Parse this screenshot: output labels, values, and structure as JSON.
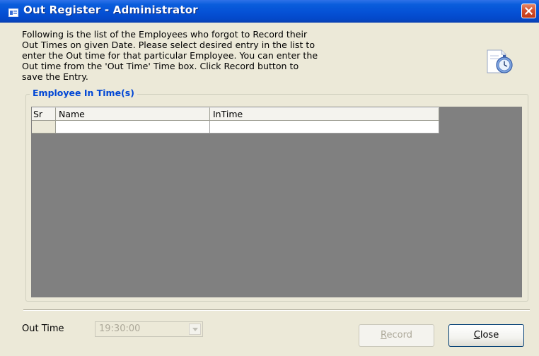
{
  "window": {
    "title": "Out Register - Administrator"
  },
  "description": {
    "lines": [
      "Following is the list of the Employees who forgot to Record their",
      "Out Times on given Date. Please select desired entry in the list to",
      "enter the Out time for that particular Employee. You can enter the",
      "Out time from the 'Out Time' Time box. Click Record button to",
      "save the Entry."
    ]
  },
  "group": {
    "title": "Employee In Time(s)"
  },
  "grid": {
    "columns": [
      "Sr",
      "Name",
      "InTime"
    ],
    "rows": [
      [
        "",
        "",
        ""
      ]
    ]
  },
  "footer": {
    "out_time_label": "Out Time",
    "out_time_value": "19:30:00",
    "record_button": {
      "mnemonic": "R",
      "rest": "ecord"
    },
    "close_button": {
      "mnemonic": "C",
      "rest": "lose"
    }
  },
  "colors": {
    "titlebar": "#0551d5",
    "group_title": "#0046d5",
    "grid_background": "#808080",
    "window_background": "#ece9d8"
  },
  "icons": [
    "window-app-icon",
    "close-x-icon",
    "stopwatch-icon",
    "dropdown-arrow-icon"
  ]
}
